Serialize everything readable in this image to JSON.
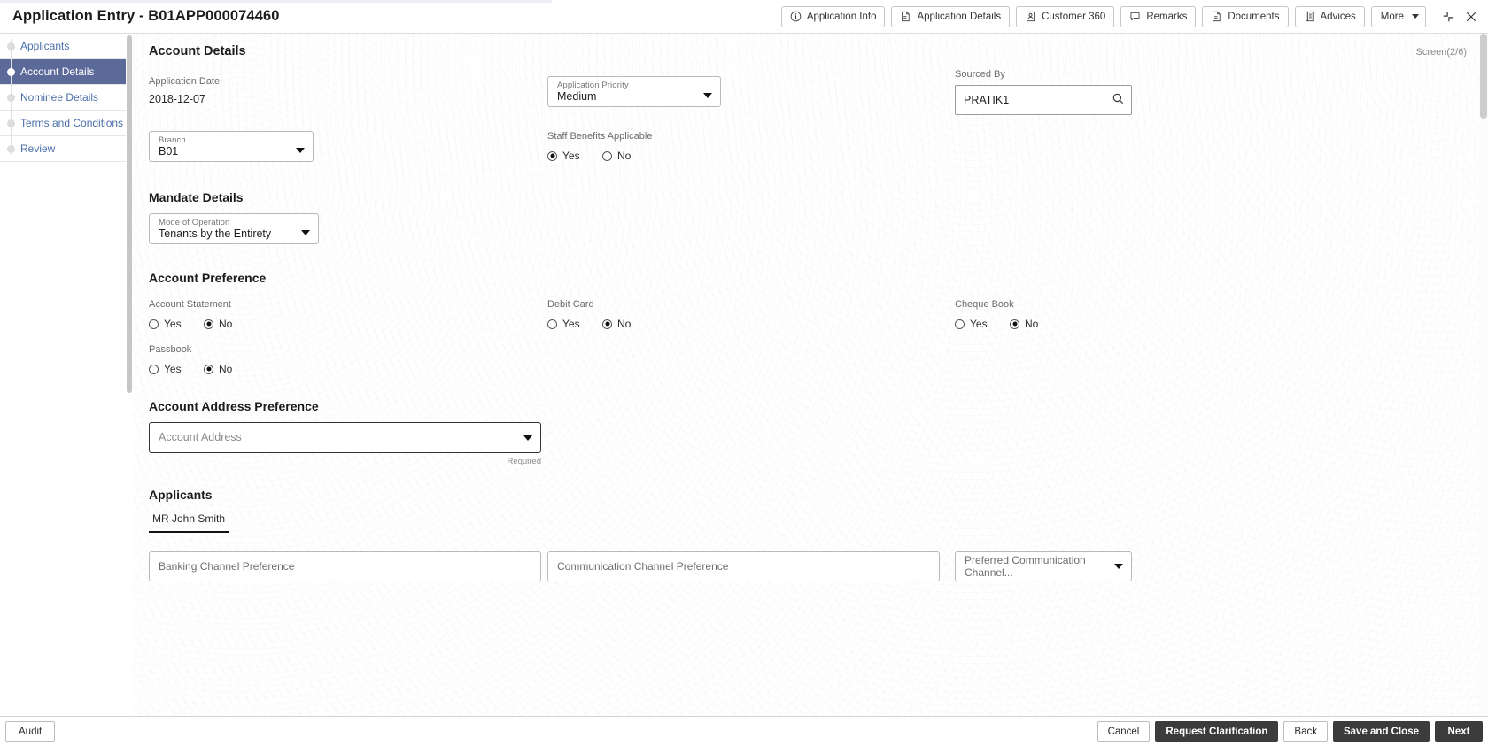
{
  "window": {
    "title": "Application Entry - B01APP000074460",
    "minimize_icon": "collapse-icon",
    "close_icon": "close-icon"
  },
  "toolbar": {
    "buttons": [
      {
        "label": "Application Info",
        "icon": "info-circle-icon"
      },
      {
        "label": "Application Details",
        "icon": "document-icon"
      },
      {
        "label": "Customer 360",
        "icon": "user-card-icon"
      },
      {
        "label": "Remarks",
        "icon": "comment-icon"
      },
      {
        "label": "Documents",
        "icon": "documents-icon"
      },
      {
        "label": "Advices",
        "icon": "advice-icon"
      }
    ],
    "more_label": "More"
  },
  "sidebar": {
    "items": [
      {
        "label": "Applicants",
        "active": false
      },
      {
        "label": "Account Details",
        "active": true
      },
      {
        "label": "Nominee Details",
        "active": false
      },
      {
        "label": "Terms and Conditions",
        "active": false
      },
      {
        "label": "Review",
        "active": false
      }
    ]
  },
  "main": {
    "page_title": "Account Details",
    "screen_indicator": "Screen(2/6)",
    "application_date": {
      "label": "Application Date",
      "value": "2018-12-07"
    },
    "branch": {
      "label": "Branch",
      "value": "B01"
    },
    "application_priority": {
      "label": "Application Priority",
      "value": "Medium"
    },
    "staff_benefits": {
      "label": "Staff Benefits Applicable",
      "yes_label": "Yes",
      "no_label": "No",
      "selected": "Yes"
    },
    "sourced_by": {
      "label": "Sourced By",
      "value": "PRATIK1",
      "icon": "search-icon"
    },
    "mandate_details": {
      "title": "Mandate Details",
      "mode_of_operation": {
        "label": "Mode of Operation",
        "value": "Tenants by the Entirety"
      }
    },
    "account_preference": {
      "title": "Account Preference",
      "groups": [
        {
          "label": "Account Statement",
          "yes_label": "Yes",
          "no_label": "No",
          "selected": "No"
        },
        {
          "label": "Debit Card",
          "yes_label": "Yes",
          "no_label": "No",
          "selected": "No"
        },
        {
          "label": "Cheque Book",
          "yes_label": "Yes",
          "no_label": "No",
          "selected": "No"
        },
        {
          "label": "Passbook",
          "yes_label": "Yes",
          "no_label": "No",
          "selected": "No"
        }
      ]
    },
    "account_address_preference": {
      "title": "Account Address Preference",
      "account_address": {
        "placeholder": "Account Address",
        "value": "",
        "helper": "Required"
      }
    },
    "applicants": {
      "title": "Applicants",
      "tab_label": "MR John Smith",
      "banking_channel": {
        "placeholder": "Banking Channel Preference",
        "value": ""
      },
      "communication_channel": {
        "placeholder": "Communication Channel Preference",
        "value": ""
      },
      "preferred_communication_channel": {
        "placeholder": "Preferred Communication Channel...",
        "value": ""
      }
    }
  },
  "footer": {
    "audit_label": "Audit",
    "cancel_label": "Cancel",
    "request_clarification_label": "Request Clarification",
    "back_label": "Back",
    "save_and_close_label": "Save and Close",
    "next_label": "Next"
  },
  "colors": {
    "active_nav": "#5b6a99",
    "nav_link": "#4a6ea9",
    "dark_button": "#3c3c3c"
  }
}
